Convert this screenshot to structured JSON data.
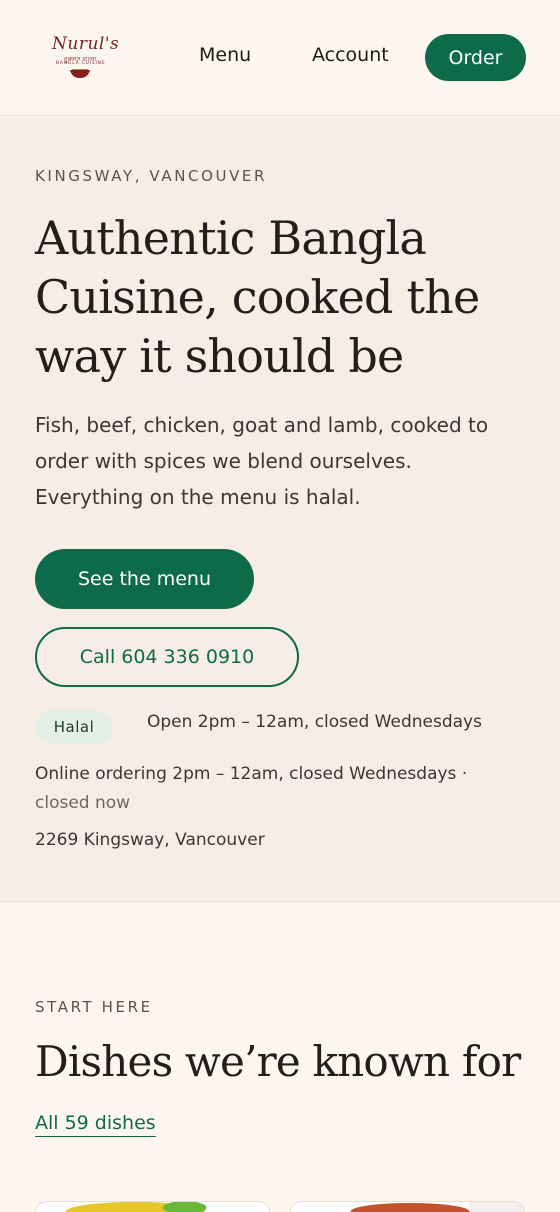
{
  "header": {
    "logo": {
      "script": "Nurul's",
      "bangla": "নুরুলস বাংলা",
      "subtitle": "BANGLA CUISINE",
      "icon": "bowl-icon"
    },
    "nav": {
      "menu_label": "Menu",
      "account_label": "Account",
      "order_label": "Order"
    }
  },
  "hero": {
    "eyebrow": "KINGSWAY, VANCOUVER",
    "title": "Authentic Bangla Cuisine, cooked the way it should be",
    "description": "Fish, beef, chicken, goat and lamb, cooked to order with spices we blend ourselves. Everything on the menu is halal.",
    "see_menu_label": "See the menu",
    "call_label": "Call 604 336 0910",
    "halal_badge": "Halal",
    "hours": "Open 2pm – 12am, closed Wednesdays",
    "online_ordering": "Online ordering 2pm – 12am, closed Wednesdays ·",
    "online_status": "closed now",
    "address": "2269 Kingsway, Vancouver"
  },
  "featured": {
    "eyebrow": "START HERE",
    "title": "Dishes we’re known for",
    "all_link": "All 59 dishes"
  },
  "colors": {
    "brand_green": "#0e6b4a",
    "background": "#fdf6ee",
    "hero_background": "#f6eee4",
    "logo_red": "#7a1f1f"
  }
}
